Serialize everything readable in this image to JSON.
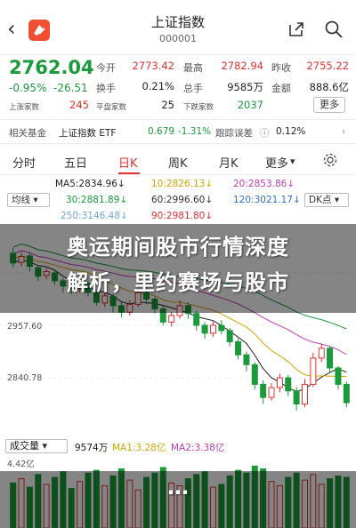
{
  "header": {
    "title": "上证指数",
    "code": "000001"
  },
  "quote": {
    "price": "2762.04",
    "pct": "-0.95%",
    "change": "-26.51",
    "fields": [
      {
        "label": "今开",
        "value": "2773.42"
      },
      {
        "label": "最高",
        "value": "2782.94"
      },
      {
        "label": "昨收",
        "value": "2755.22"
      },
      {
        "label": "换手",
        "value": "0.21%"
      },
      {
        "label": "总手",
        "value": "9585万"
      },
      {
        "label": "金额",
        "value": "888.6亿"
      }
    ],
    "up_label": "上涨家数",
    "up_count": "245",
    "flat_label": "平盘家数",
    "flat_count": "25",
    "down_label": "下跌家数",
    "down_count": "2037",
    "more": "更多"
  },
  "fund": {
    "label": "相关基金",
    "name": "上证指数 ETF",
    "price": "0.679",
    "pct": "-1.31%",
    "err_label": "跟踪误差",
    "err": "0.12%"
  },
  "tabs": [
    "分时",
    "五日",
    "日K",
    "周K",
    "月K",
    "更多"
  ],
  "active_tab": "日K",
  "ma": {
    "select": "均线",
    "ma5": "MA5:2834.96↓",
    "ma10": "10:2826.13↓",
    "ma20": "20:2853.86↓",
    "ma30": "30:2881.89↓",
    "ma60": "60:2996.60↓",
    "ma120": "120:3021.17↓",
    "ma250": "250:3146.48↓",
    "ma90": "90:2981.80↓",
    "adjust": "DK点"
  },
  "y_axis": [
    "2957.60",
    "2840.78"
  ],
  "volume": {
    "select": "成交量",
    "vol": "9574万",
    "ma1": "MA1:3.28亿",
    "ma2": "MA2:3.38亿",
    "max": "4.42亿"
  },
  "overlay": {
    "line1": "奥运期间股市行情深度",
    "line2": "解析，里约赛场与股市",
    "line3": "…"
  },
  "colors": {
    "up": "#e53030",
    "down": "#1a9a3a",
    "ma5": "#222222",
    "ma10": "#d9a400",
    "ma20": "#c23fb5",
    "ma30": "#1a9a3a",
    "ma60": "#333333",
    "ma120": "#3070d0",
    "ma250": "#6fa8dc",
    "ma90": "#e53030"
  },
  "chart_data": {
    "type": "candlestick",
    "candles": [
      {
        "o": 2990,
        "c": 2975,
        "h": 2998,
        "l": 2968
      },
      {
        "o": 2976,
        "c": 2985,
        "h": 2992,
        "l": 2970
      },
      {
        "o": 2986,
        "c": 2970,
        "h": 2990,
        "l": 2962
      },
      {
        "o": 2968,
        "c": 2955,
        "h": 2972,
        "l": 2948
      },
      {
        "o": 2956,
        "c": 2962,
        "h": 2968,
        "l": 2950
      },
      {
        "o": 2960,
        "c": 2948,
        "h": 2965,
        "l": 2942
      },
      {
        "o": 2948,
        "c": 2940,
        "h": 2952,
        "l": 2930
      },
      {
        "o": 2940,
        "c": 2935,
        "h": 2946,
        "l": 2928
      },
      {
        "o": 2936,
        "c": 2945,
        "h": 2950,
        "l": 2930
      },
      {
        "o": 2944,
        "c": 2930,
        "h": 2948,
        "l": 2924
      },
      {
        "o": 2930,
        "c": 2915,
        "h": 2934,
        "l": 2910
      },
      {
        "o": 2914,
        "c": 2925,
        "h": 2930,
        "l": 2908
      },
      {
        "o": 2924,
        "c": 2910,
        "h": 2928,
        "l": 2900
      },
      {
        "o": 2910,
        "c": 2900,
        "h": 2915,
        "l": 2892
      },
      {
        "o": 2900,
        "c": 2912,
        "h": 2918,
        "l": 2895
      },
      {
        "o": 2912,
        "c": 2930,
        "h": 2936,
        "l": 2908
      },
      {
        "o": 2930,
        "c": 2920,
        "h": 2938,
        "l": 2912
      },
      {
        "o": 2920,
        "c": 2905,
        "h": 2924,
        "l": 2898
      },
      {
        "o": 2905,
        "c": 2885,
        "h": 2910,
        "l": 2880
      },
      {
        "o": 2885,
        "c": 2895,
        "h": 2900,
        "l": 2878
      },
      {
        "o": 2895,
        "c": 2910,
        "h": 2918,
        "l": 2890
      },
      {
        "o": 2910,
        "c": 2898,
        "h": 2915,
        "l": 2890
      },
      {
        "o": 2898,
        "c": 2880,
        "h": 2902,
        "l": 2872
      },
      {
        "o": 2880,
        "c": 2868,
        "h": 2885,
        "l": 2860
      },
      {
        "o": 2868,
        "c": 2880,
        "h": 2886,
        "l": 2862
      },
      {
        "o": 2880,
        "c": 2872,
        "h": 2888,
        "l": 2866
      },
      {
        "o": 2872,
        "c": 2855,
        "h": 2876,
        "l": 2848
      },
      {
        "o": 2855,
        "c": 2835,
        "h": 2860,
        "l": 2828
      },
      {
        "o": 2835,
        "c": 2820,
        "h": 2840,
        "l": 2810
      },
      {
        "o": 2820,
        "c": 2790,
        "h": 2824,
        "l": 2782
      },
      {
        "o": 2790,
        "c": 2770,
        "h": 2796,
        "l": 2760
      },
      {
        "o": 2770,
        "c": 2785,
        "h": 2792,
        "l": 2765
      },
      {
        "o": 2785,
        "c": 2800,
        "h": 2806,
        "l": 2778
      },
      {
        "o": 2800,
        "c": 2780,
        "h": 2804,
        "l": 2772
      },
      {
        "o": 2780,
        "c": 2760,
        "h": 2786,
        "l": 2750
      },
      {
        "o": 2760,
        "c": 2790,
        "h": 2798,
        "l": 2755
      },
      {
        "o": 2790,
        "c": 2830,
        "h": 2838,
        "l": 2786
      },
      {
        "o": 2830,
        "c": 2845,
        "h": 2852,
        "l": 2824
      },
      {
        "o": 2845,
        "c": 2815,
        "h": 2848,
        "l": 2808
      },
      {
        "o": 2815,
        "c": 2790,
        "h": 2818,
        "l": 2782
      },
      {
        "o": 2790,
        "c": 2762,
        "h": 2794,
        "l": 2755
      }
    ],
    "volume": [
      3.2,
      3.5,
      2.9,
      3.8,
      3.1,
      3.6,
      4.0,
      2.8,
      3.3,
      3.9,
      4.1,
      3.0,
      3.7,
      4.2,
      3.4,
      2.7,
      3.6,
      3.9,
      4.3,
      3.2,
      3.0,
      3.5,
      3.8,
      4.0,
      2.9,
      3.1,
      3.7,
      4.1,
      3.9,
      4.4,
      4.2,
      3.3,
      3.0,
      3.6,
      3.9,
      3.4,
      3.8,
      3.1,
      3.5,
      3.7,
      3.6
    ],
    "ylim": [
      2720,
      3040
    ],
    "vol_max": 4.42
  }
}
